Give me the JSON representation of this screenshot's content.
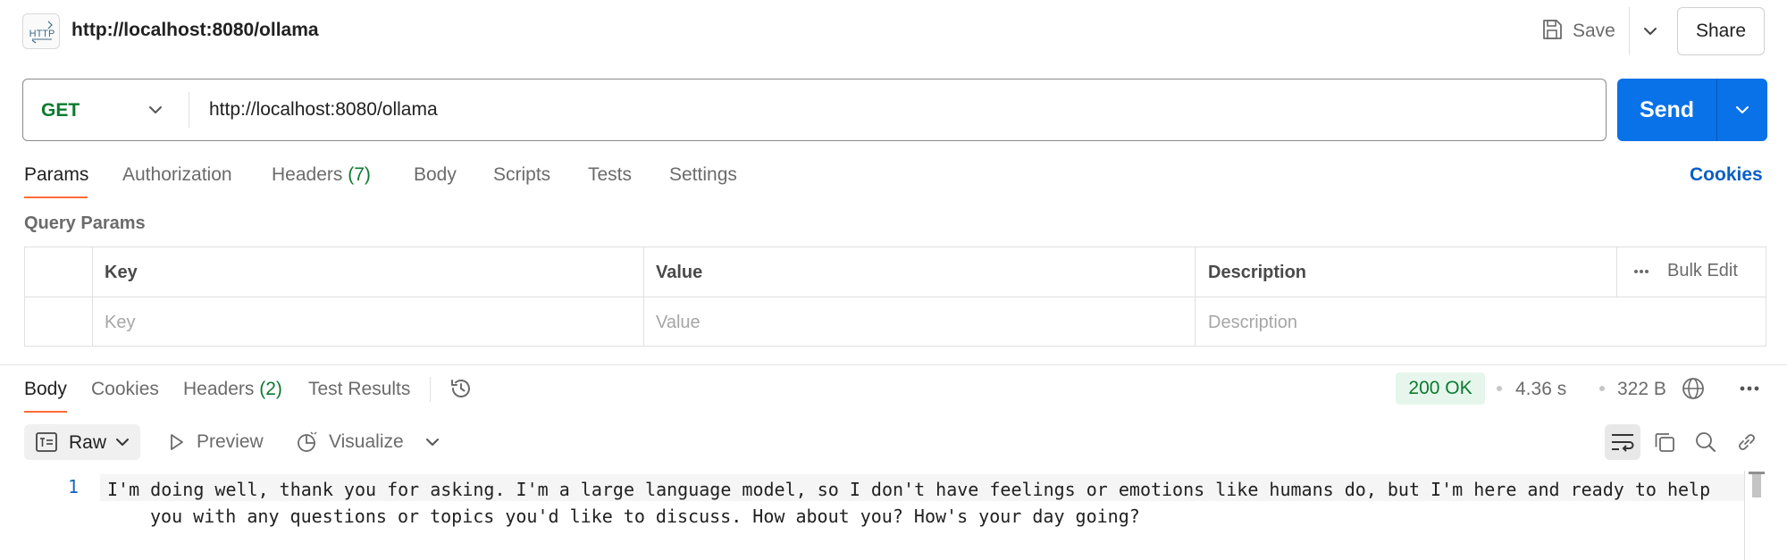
{
  "header": {
    "icon_text": "HTTP",
    "title": "http://localhost:8080/ollama",
    "save_label": "Save",
    "share_label": "Share"
  },
  "request": {
    "method": "GET",
    "url": "http://localhost:8080/ollama",
    "send_label": "Send"
  },
  "request_tabs": [
    {
      "label": "Params",
      "active": true
    },
    {
      "label": "Authorization"
    },
    {
      "label": "Headers",
      "count": "(7)"
    },
    {
      "label": "Body"
    },
    {
      "label": "Scripts"
    },
    {
      "label": "Tests"
    },
    {
      "label": "Settings"
    }
  ],
  "cookies_label": "Cookies",
  "query_params": {
    "title": "Query Params",
    "columns": [
      "Key",
      "Value",
      "Description"
    ],
    "placeholders": {
      "key": "Key",
      "value": "Value",
      "description": "Description"
    },
    "bulk_edit_label": "Bulk Edit"
  },
  "response_tabs": [
    {
      "label": "Body",
      "active": true
    },
    {
      "label": "Cookies"
    },
    {
      "label": "Headers",
      "count": "(2)"
    },
    {
      "label": "Test Results"
    }
  ],
  "response_meta": {
    "status": "200 OK",
    "time": "4.36 s",
    "size": "322 B"
  },
  "response_toolbar": {
    "format_label": "Raw",
    "preview_label": "Preview",
    "visualize_label": "Visualize"
  },
  "response_body": {
    "lines": [
      {
        "number": "1",
        "text": "I'm doing well, thank you for asking. I'm a large language model, so I don't have feelings or emotions like humans do, but I'm here and ready to help you with any questions or topics you'd like to discuss. How about you? How's your day going?"
      }
    ]
  },
  "colors": {
    "accent_blue": "#0a72e8",
    "method_green": "#0b7a2f",
    "tab_underline": "#ff6c37",
    "link_blue": "#0a5fc4",
    "status_bg": "#e6f6ec"
  },
  "icons": [
    "http-request-icon",
    "save-icon",
    "chevron-down-icon",
    "history-icon",
    "globe-icon",
    "more-icon",
    "raw-format-icon",
    "play-icon",
    "visualize-icon",
    "wrap-lines-icon",
    "copy-icon",
    "search-icon",
    "link-icon"
  ]
}
